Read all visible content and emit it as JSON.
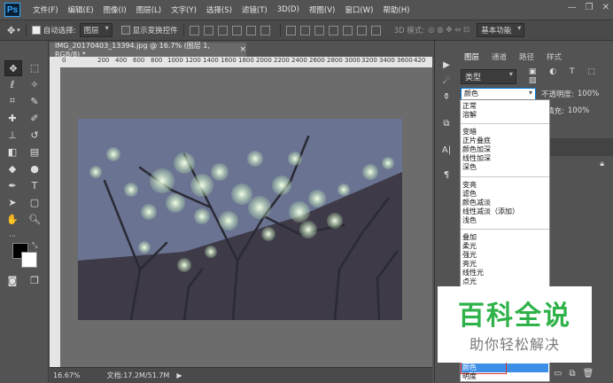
{
  "app": {
    "logo": "Ps"
  },
  "menu": [
    "文件(F)",
    "编辑(E)",
    "图像(I)",
    "图层(L)",
    "文字(Y)",
    "选择(S)",
    "滤镜(T)",
    "3D(D)",
    "视图(V)",
    "窗口(W)",
    "帮助(H)"
  ],
  "window_controls": {
    "minimize": "—",
    "restore": "❐",
    "close": "✕"
  },
  "options": {
    "auto_select_label": "自动选择:",
    "auto_select_value": "图层",
    "transform_label": "显示变换控件",
    "mode_3d_label": "3D 模式:",
    "workspace": "基本功能"
  },
  "document": {
    "tab_title": "IMG_20170403_13394.jpg @ 16.7% (图层 1, RGB/8) *",
    "close_glyph": "×",
    "ruler_ticks": [
      "0",
      "200",
      "400",
      "600",
      "800",
      "1000",
      "1200",
      "1400",
      "1600",
      "1800",
      "2000",
      "2200",
      "2400",
      "2600",
      "2800",
      "3000",
      "3200",
      "3400",
      "3600",
      "3800",
      "4000",
      "420"
    ],
    "zoom": "16.67%",
    "file_info": "文档:17.2M/51.7M",
    "status_arrow": "▶"
  },
  "panel": {
    "tabs": [
      "图层",
      "通道",
      "路径",
      "样式"
    ],
    "filter_kind": "类型",
    "blend_mode": "颜色",
    "opacity_label": "不透明度:",
    "opacity_value": "100%",
    "fill_label": "填充:",
    "fill_value": "100%"
  },
  "blend_modes": {
    "group1": [
      "正常",
      "溶解"
    ],
    "group2": [
      "变暗",
      "正片叠底",
      "颜色加深",
      "线性加深",
      "深色"
    ],
    "group3": [
      "变亮",
      "滤色",
      "颜色减淡",
      "线性减淡（添加）",
      "浅色"
    ],
    "group4": [
      "叠加",
      "柔光",
      "强光",
      "亮光",
      "线性光",
      "点光"
    ],
    "bottom": [
      "明度"
    ],
    "selected": "颜色"
  },
  "watermark": {
    "title": "百科全说",
    "subtitle": "助你轻松解决"
  },
  "colors": {
    "ui_dark": "#535353",
    "accent_select": "#3d8ee6",
    "watermark_green": "#2fb24a",
    "highlight_box": "#e03030"
  }
}
